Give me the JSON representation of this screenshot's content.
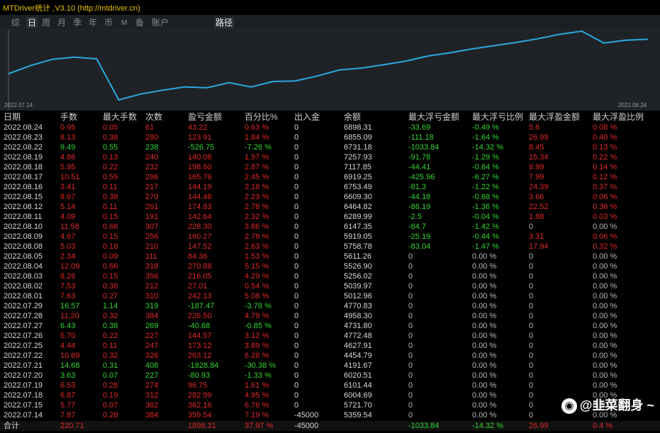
{
  "window": {
    "title": "MTDriver统计 ,V3.10 (http://mtdriver.cn)"
  },
  "tabs": [
    "综",
    "日",
    "周",
    "月",
    "季",
    "年",
    "币",
    "M",
    "备",
    "账户",
    "路径"
  ],
  "chart": {
    "start_label": "2022.07.14",
    "end_label": "2022.08.24",
    "line_color": "#2aa9e0",
    "values": [
      5359.54,
      5721.7,
      6004.69,
      6101.44,
      6020.51,
      4191.67,
      4454.79,
      4627.91,
      4772.48,
      4731.8,
      4958.3,
      4770.83,
      5012.96,
      5039.97,
      5256.02,
      5526.9,
      5611.26,
      5758.78,
      5919.05,
      6147.35,
      6289.99,
      6464.82,
      6609.3,
      6753.49,
      6919.25,
      7117.85,
      7257.93,
      6731.18,
      6855.09,
      6898.31
    ]
  },
  "table": {
    "headers": [
      "日期",
      "手数",
      "最大手数",
      "次数",
      "盈亏金额",
      "百分比%",
      "出入金",
      "余额",
      "最大浮亏金额",
      "最大浮亏比例",
      "最大浮盈金额",
      "最大浮盈比例"
    ],
    "rows": [
      [
        "2022.08.24",
        "0.95",
        "0.05",
        "61",
        "43.22",
        "0.63 %",
        "0",
        "6898.31",
        "-33.69",
        "-0.49 %",
        "5.6",
        "0.08 %"
      ],
      [
        "2022.08.23",
        "8.13",
        "0.38",
        "280",
        "123.91",
        "1.84 %",
        "0",
        "6855.09",
        "-111.18",
        "-1.64 %",
        "26.99",
        "0.40 %"
      ],
      [
        "2022.08.22",
        "9.49",
        "0.55",
        "238",
        "-526.75",
        "-7.26 %",
        "0",
        "6731.18",
        "-1033.84",
        "-14.32 %",
        "8.45",
        "0.13 %"
      ],
      [
        "2022.08.19",
        "4.86",
        "0.13",
        "240",
        "140.08",
        "1.97 %",
        "0",
        "7257.93",
        "-91.78",
        "-1.29 %",
        "15.34",
        "0.22 %"
      ],
      [
        "2022.08.18",
        "5.95",
        "0.22",
        "232",
        "198.60",
        "2.87 %",
        "0",
        "7117.85",
        "-44.41",
        "-0.64 %",
        "9.99",
        "0.14 %"
      ],
      [
        "2022.08.17",
        "10.51",
        "0.55",
        "286",
        "165.76",
        "2.45 %",
        "0",
        "6919.25",
        "-425.96",
        "-6.27 %",
        "7.99",
        "0.12 %"
      ],
      [
        "2022.08.16",
        "3.41",
        "0.11",
        "217",
        "144.19",
        "2.18 %",
        "0",
        "6753.49",
        "-81.3",
        "-1.22 %",
        "24.39",
        "0.37 %"
      ],
      [
        "2022.08.15",
        "8.67",
        "0.38",
        "270",
        "144.48",
        "2.23 %",
        "0",
        "6609.30",
        "-44.18",
        "-0.68 %",
        "3.66",
        "0.06 %"
      ],
      [
        "2022.08.12",
        "5.14",
        "0.11",
        "261",
        "174.83",
        "2.78 %",
        "0",
        "6464.82",
        "-86.19",
        "-1.36 %",
        "22.52",
        "0.36 %"
      ],
      [
        "2022.08.11",
        "4.09",
        "0.15",
        "191",
        "142.64",
        "2.32 %",
        "0",
        "6289.99",
        "-2.5",
        "-0.04 %",
        "1.88",
        "0.03 %"
      ],
      [
        "2022.08.10",
        "11.58",
        "0.66",
        "307",
        "228.30",
        "3.86 %",
        "0",
        "6147.35",
        "-84.7",
        "-1.42 %",
        "0",
        "0.00 %"
      ],
      [
        "2022.08.09",
        "4.67",
        "0.15",
        "256",
        "160.27",
        "2.78 %",
        "0",
        "5919.05",
        "-25.19",
        "-0.44 %",
        "3.31",
        "0.06 %"
      ],
      [
        "2022.08.08",
        "5.03",
        "0.18",
        "210",
        "147.52",
        "2.63 %",
        "0",
        "5758.78",
        "-83.04",
        "-1.47 %",
        "17.94",
        "0.32 %"
      ],
      [
        "2022.08.05",
        "2.34",
        "0.09",
        "111",
        "84.36",
        "1.53 %",
        "0",
        "5611.26",
        "0",
        "0.00 %",
        "0",
        "0.00 %"
      ],
      [
        "2022.08.04",
        "12.09",
        "0.66",
        "318",
        "270.88",
        "5.15 %",
        "0",
        "5526.90",
        "0",
        "0.00 %",
        "0",
        "0.00 %"
      ],
      [
        "2022.08.03",
        "8.26",
        "0.15",
        "356",
        "216.05",
        "4.29 %",
        "0",
        "5256.02",
        "0",
        "0.00 %",
        "0",
        "0.00 %"
      ],
      [
        "2022.08.02",
        "7.53",
        "0.38",
        "212",
        "27.01",
        "0.54 %",
        "0",
        "5039.97",
        "0",
        "0.00 %",
        "0",
        "0.00 %"
      ],
      [
        "2022.08.01",
        "7.63",
        "0.27",
        "310",
        "242.13",
        "5.08 %",
        "0",
        "5012.96",
        "0",
        "0.00 %",
        "0",
        "0.00 %"
      ],
      [
        "2022.07.29",
        "16.57",
        "1.14",
        "319",
        "-187.47",
        "-3.78 %",
        "0",
        "4770.83",
        "0",
        "0.00 %",
        "0",
        "0.00 %"
      ],
      [
        "2022.07.28",
        "11.20",
        "0.32",
        "384",
        "226.50",
        "4.79 %",
        "0",
        "4958.30",
        "0",
        "0.00 %",
        "0",
        "0.00 %"
      ],
      [
        "2022.07.27",
        "6.43",
        "0.38",
        "269",
        "-40.68",
        "-0.85 %",
        "0",
        "4731.80",
        "0",
        "0.00 %",
        "0",
        "0.00 %"
      ],
      [
        "2022.07.26",
        "5.70",
        "0.22",
        "227",
        "144.57",
        "3.12 %",
        "0",
        "4772.48",
        "0",
        "0.00 %",
        "0",
        "0.00 %"
      ],
      [
        "2022.07.25",
        "4.44",
        "0.11",
        "247",
        "173.12",
        "3.89 %",
        "0",
        "4627.91",
        "0",
        "0.00 %",
        "0",
        "0.00 %"
      ],
      [
        "2022.07.22",
        "10.69",
        "0.32",
        "326",
        "263.12",
        "6.28 %",
        "0",
        "4454.79",
        "0",
        "0.00 %",
        "0",
        "0.00 %"
      ],
      [
        "2022.07.21",
        "14.68",
        "0.31",
        "408",
        "-1828.84",
        "-30.38 %",
        "0",
        "4191.67",
        "0",
        "0.00 %",
        "0",
        "0.00 %"
      ],
      [
        "2022.07.20",
        "3.63",
        "0.07",
        "227",
        "-80.93",
        "-1.33 %",
        "0",
        "6020.51",
        "0",
        "0.00 %",
        "0",
        "0.00 %"
      ],
      [
        "2022.07.19",
        "6.53",
        "0.28",
        "274",
        "96.75",
        "1.61 %",
        "0",
        "6101.44",
        "0",
        "0.00 %",
        "0",
        "0.00 %"
      ],
      [
        "2022.07.18",
        "6.87",
        "0.19",
        "312",
        "282.99",
        "4.95 %",
        "0",
        "6004.69",
        "0",
        "0.00 %",
        "0",
        "0.00 %"
      ],
      [
        "2022.07.15",
        "5.77",
        "0.07",
        "362",
        "362.16",
        "6.76 %",
        "0",
        "5721.70",
        "0",
        "0.00 %",
        "0",
        "0.00 %"
      ],
      [
        "2022.07.14",
        "7.87",
        "0.28",
        "384",
        "359.54",
        "7.19 %",
        "-45000",
        "5359.54",
        "0",
        "0.00 %",
        "0",
        "0.00 %"
      ]
    ],
    "total": [
      "合计",
      "220.71",
      "",
      "",
      "1898.31",
      "37.97 %",
      "-45000",
      "",
      "-1033.84",
      "-14.32 %",
      "26.99",
      "0.4 %"
    ]
  },
  "watermark": {
    "icon": "微博",
    "text": "@韭菜翻身 ~"
  }
}
